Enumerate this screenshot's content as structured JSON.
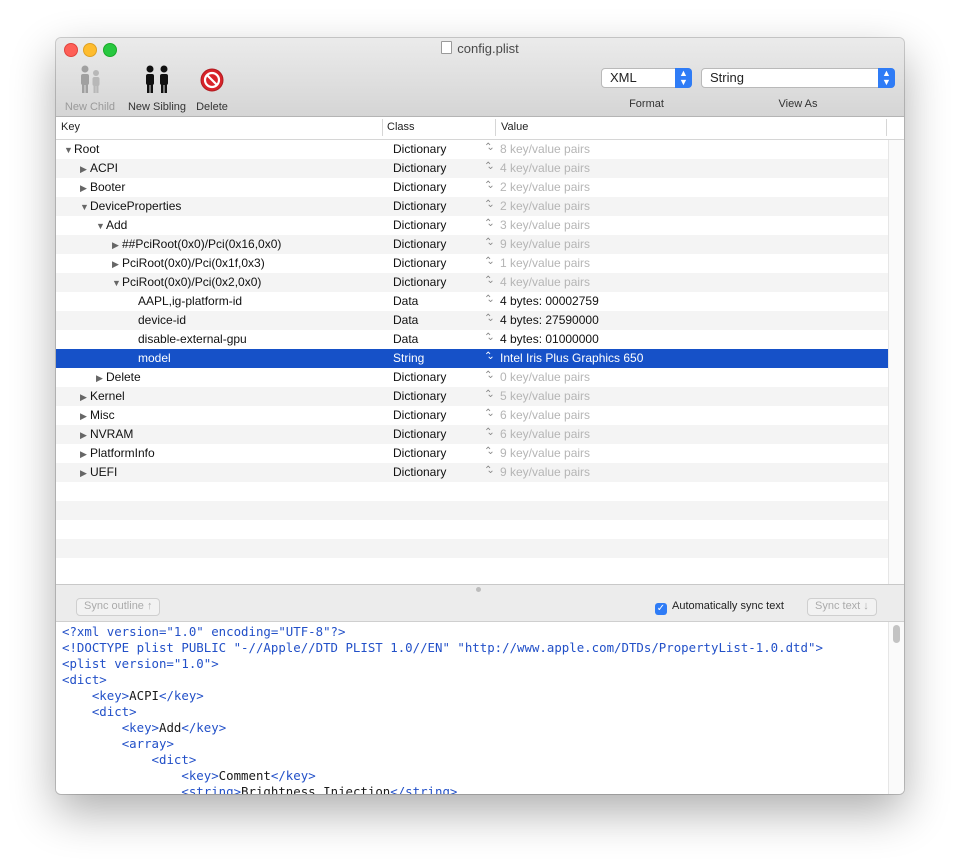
{
  "window": {
    "title": "config.plist"
  },
  "toolbar": {
    "new_child": "New Child",
    "new_sibling": "New Sibling",
    "delete": "Delete",
    "format_value": "XML",
    "format_label": "Format",
    "view_as_value": "String",
    "view_as_label": "View As"
  },
  "columns": {
    "key": "Key",
    "class": "Class",
    "value": "Value"
  },
  "rows": [
    {
      "key": "Root",
      "disclosure": "open",
      "class": "Dictionary",
      "value": "8 key/value pairs",
      "dim": true
    },
    {
      "key": "ACPI",
      "disclosure": "closed",
      "class": "Dictionary",
      "value": "4 key/value pairs",
      "dim": true
    },
    {
      "key": "Booter",
      "disclosure": "closed",
      "class": "Dictionary",
      "value": "2 key/value pairs",
      "dim": true
    },
    {
      "key": "DeviceProperties",
      "disclosure": "open",
      "class": "Dictionary",
      "value": "2 key/value pairs",
      "dim": true
    },
    {
      "key": "Add",
      "disclosure": "open",
      "class": "Dictionary",
      "value": "3 key/value pairs",
      "dim": true
    },
    {
      "key": "##PciRoot(0x0)/Pci(0x16,0x0)",
      "disclosure": "closed",
      "class": "Dictionary",
      "value": "9 key/value pairs",
      "dim": true
    },
    {
      "key": "PciRoot(0x0)/Pci(0x1f,0x3)",
      "disclosure": "closed",
      "class": "Dictionary",
      "value": "1 key/value pairs",
      "dim": true
    },
    {
      "key": "PciRoot(0x0)/Pci(0x2,0x0)",
      "disclosure": "open",
      "class": "Dictionary",
      "value": "4 key/value pairs",
      "dim": true
    },
    {
      "key": "AAPL,ig-platform-id",
      "disclosure": "none",
      "class": "Data",
      "value": "4 bytes: 00002759",
      "dim": false
    },
    {
      "key": "device-id",
      "disclosure": "none",
      "class": "Data",
      "value": "4 bytes: 27590000",
      "dim": false
    },
    {
      "key": "disable-external-gpu",
      "disclosure": "none",
      "class": "Data",
      "value": "4 bytes: 01000000",
      "dim": false
    },
    {
      "key": "model",
      "disclosure": "none",
      "class": "String",
      "value": "Intel Iris Plus Graphics 650",
      "dim": false,
      "selected": true
    },
    {
      "key": "Delete",
      "disclosure": "closed",
      "class": "Dictionary",
      "value": "0 key/value pairs",
      "dim": true
    },
    {
      "key": "Kernel",
      "disclosure": "closed",
      "class": "Dictionary",
      "value": "5 key/value pairs",
      "dim": true
    },
    {
      "key": "Misc",
      "disclosure": "closed",
      "class": "Dictionary",
      "value": "6 key/value pairs",
      "dim": true
    },
    {
      "key": "NVRAM",
      "disclosure": "closed",
      "class": "Dictionary",
      "value": "6 key/value pairs",
      "dim": true
    },
    {
      "key": "PlatformInfo",
      "disclosure": "closed",
      "class": "Dictionary",
      "value": "9 key/value pairs",
      "dim": true
    },
    {
      "key": "UEFI",
      "disclosure": "closed",
      "class": "Dictionary",
      "value": "9 key/value pairs",
      "dim": true
    }
  ],
  "sync": {
    "sync_outline": "Sync outline ↑",
    "auto_sync_label": "Automatically sync text",
    "auto_sync_checked": true,
    "sync_text": "Sync text ↓"
  },
  "editor_lines": [
    "<?xml version=\"1.0\" encoding=\"UTF-8\"?>",
    "<!DOCTYPE plist PUBLIC \"-//Apple//DTD PLIST 1.0//EN\" \"http://www.apple.com/DTDs/PropertyList-1.0.dtd\">",
    "<plist version=\"1.0\">",
    "<dict>",
    "    <key>ACPI</key>",
    "    <dict>",
    "        <key>Add</key>",
    "        <array>",
    "            <dict>",
    "                <key>Comment</key>",
    "                <string>Brightness Injection</string>"
  ],
  "colors": {
    "selection": "#1651c8",
    "accent": "#2f7cf6",
    "xml_tag": "#2250c8"
  },
  "icons": [
    "person-icon",
    "two-persons-icon",
    "delete-icon",
    "document-icon",
    "stepper-icon"
  ]
}
